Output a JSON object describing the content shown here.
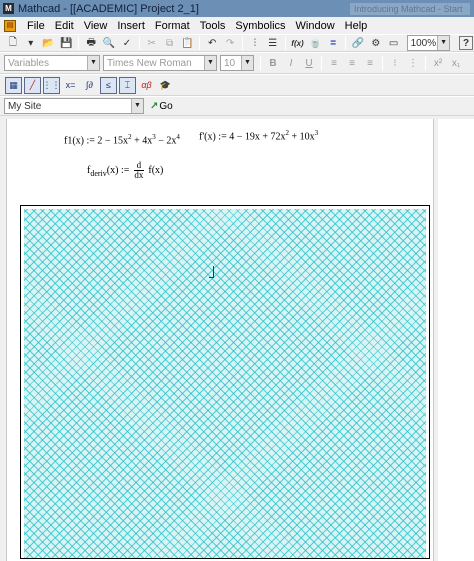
{
  "window": {
    "title": "Mathcad - [[ACADEMIC] Project 2_1]",
    "app_icon": "M",
    "other_tab_title": "Introducing Mathcad - Start"
  },
  "menu": {
    "items": [
      "File",
      "Edit",
      "View",
      "Insert",
      "Format",
      "Tools",
      "Symbolics",
      "Window",
      "Help"
    ]
  },
  "toolbar": {
    "zoom": "100%",
    "help": "?",
    "calc": "f(x)",
    "equals": "="
  },
  "format_bar": {
    "style": "Variables",
    "font": "Times New Roman",
    "size": "10",
    "bold": "B",
    "italic": "I",
    "underline": "U",
    "superscript": "x²",
    "subscript": "x₁"
  },
  "math_bar": {
    "eval": "x=",
    "calculus": "∫∂",
    "greek": "αβ"
  },
  "resource_bar": {
    "site": "My Site",
    "go": "Go"
  },
  "worksheet": {
    "eq1": {
      "lhs": "f1(x)",
      "assign": ":=",
      "rhs_a": "2 − 15x",
      "exp_a": "2",
      "rhs_b": " + 4x",
      "exp_b": "3",
      "rhs_c": " − 2x",
      "exp_c": "4"
    },
    "eq2": {
      "lhs": "f'(x)",
      "assign": ":=",
      "rhs_a": "4 − 19x + 72x",
      "exp_a": "2",
      "rhs_b": " + 10x",
      "exp_b": "3"
    },
    "eq3": {
      "lhs": "f",
      "sub": "deriv",
      "arg": "(x)",
      "assign": ":=",
      "num": "d",
      "den": "dx",
      "rhs": "f(x)"
    }
  },
  "colors": {
    "grid": "#28bec8",
    "cursor": "#1a2fb0",
    "titlebar": "#6b8fb5"
  }
}
